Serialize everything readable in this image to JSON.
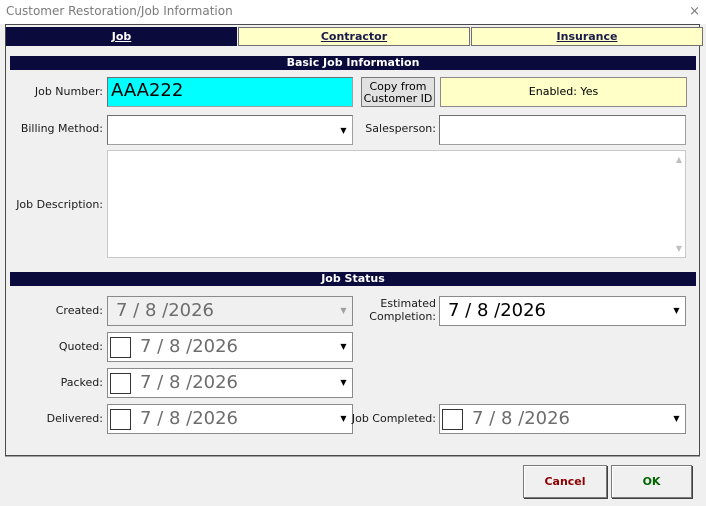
{
  "window": {
    "title": "Customer Restoration/Job Information",
    "close_glyph": "×"
  },
  "tabs": [
    {
      "label": "Job",
      "active": true
    },
    {
      "label": "Contractor",
      "active": false
    },
    {
      "label": "Insurance",
      "active": false
    }
  ],
  "basic": {
    "header": "Basic Job Information",
    "job_number_label": "Job Number:",
    "job_number_value": "AAA222",
    "copy_button_line1": "Copy from",
    "copy_button_line2": "Customer ID",
    "enabled_text": "Enabled: Yes",
    "billing_label": "Billing Method:",
    "billing_value": "",
    "salesperson_label": "Salesperson:",
    "salesperson_value": "",
    "description_label": "Job Description:",
    "description_value": ""
  },
  "status": {
    "header": "Job Status",
    "created_label": "Created:",
    "created_value": "7 / 8 /2026",
    "estimated_label_line1": "Estimated",
    "estimated_label_line2": "Completion:",
    "estimated_value": "7 / 8 /2026",
    "quoted_label": "Quoted:",
    "quoted_value": "7 / 8 /2026",
    "packed_label": "Packed:",
    "packed_value": "7 / 8 /2026",
    "delivered_label": "Delivered:",
    "delivered_value": "7 / 8 /2026",
    "completed_label": "Job Completed:",
    "completed_value": "7 / 8 /2026"
  },
  "footer": {
    "cancel_label": "Cancel",
    "ok_label": "OK"
  },
  "colors": {
    "navy": "#0a0a3c",
    "cyan": "#00ffff",
    "pale_yellow": "#ffffc8",
    "cancel_text": "#8b0000",
    "ok_text": "#006400"
  }
}
